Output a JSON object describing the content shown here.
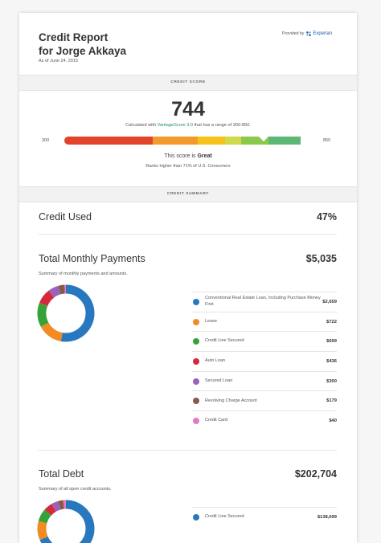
{
  "header": {
    "title_line1": "Credit Report",
    "title_line2": "for Jorge Akkaya",
    "as_of": "As of June 24, 2015",
    "provided_by": "Provided by",
    "provider": "Experian"
  },
  "credit_score": {
    "band_label": "CREDIT SCORE",
    "score": "744",
    "calc_prefix": "Calculated with ",
    "calc_link": "VantageScore 3.0",
    "calc_suffix": " that has a range of 300-850.",
    "range_min": "300",
    "range_max": "850",
    "score_text_prefix": "This score is ",
    "score_rating": "Great",
    "rank_text": "Ranks higher than 71% of U.S. Consumers",
    "score_value": 744,
    "scale_min": 300,
    "scale_max": 850,
    "bar_colors": [
      "#e2432a",
      "#f39a2c",
      "#f6c21c",
      "#cfd94a",
      "#8cc94b",
      "#5cb874"
    ]
  },
  "credit_summary": {
    "band_label": "CREDIT SUMMARY",
    "credit_used": {
      "label": "Credit Used",
      "value": "47%"
    },
    "monthly": {
      "label": "Total Monthly Payments",
      "value": "$5,035",
      "subtitle": "Summary of monthly payments and amounts.",
      "items": [
        {
          "name": "Conventional Real Estate Loan, Including Purchase Money First",
          "value": "$2,659",
          "amount": 2659,
          "color": "#2878c0"
        },
        {
          "name": "Lease",
          "value": "$722",
          "amount": 722,
          "color": "#f28b24"
        },
        {
          "name": "Credit Line Secured",
          "value": "$699",
          "amount": 699,
          "color": "#36a33a"
        },
        {
          "name": "Auto Loan",
          "value": "$436",
          "amount": 436,
          "color": "#d6283a"
        },
        {
          "name": "Secured Loan",
          "value": "$300",
          "amount": 300,
          "color": "#9a62b8"
        },
        {
          "name": "Revolving Charge Account",
          "value": "$179",
          "amount": 179,
          "color": "#8a5a48"
        },
        {
          "name": "Credit Card",
          "value": "$40",
          "amount": 40,
          "color": "#e37ac6"
        }
      ]
    },
    "debt": {
      "label": "Total Debt",
      "value": "$202,704",
      "subtitle": "Summary of all open credit accounts.",
      "items": [
        {
          "name": "Credit Line Secured",
          "value": "$138,699",
          "amount": 138699,
          "color": "#2878c0"
        }
      ],
      "donut_colors": [
        "#2878c0",
        "#f28b24",
        "#36a33a",
        "#d6283a",
        "#9a62b8",
        "#8a5a48",
        "#e37ac6"
      ],
      "donut_amounts": [
        138699,
        22000,
        15000,
        10000,
        8000,
        6000,
        3005
      ]
    }
  }
}
